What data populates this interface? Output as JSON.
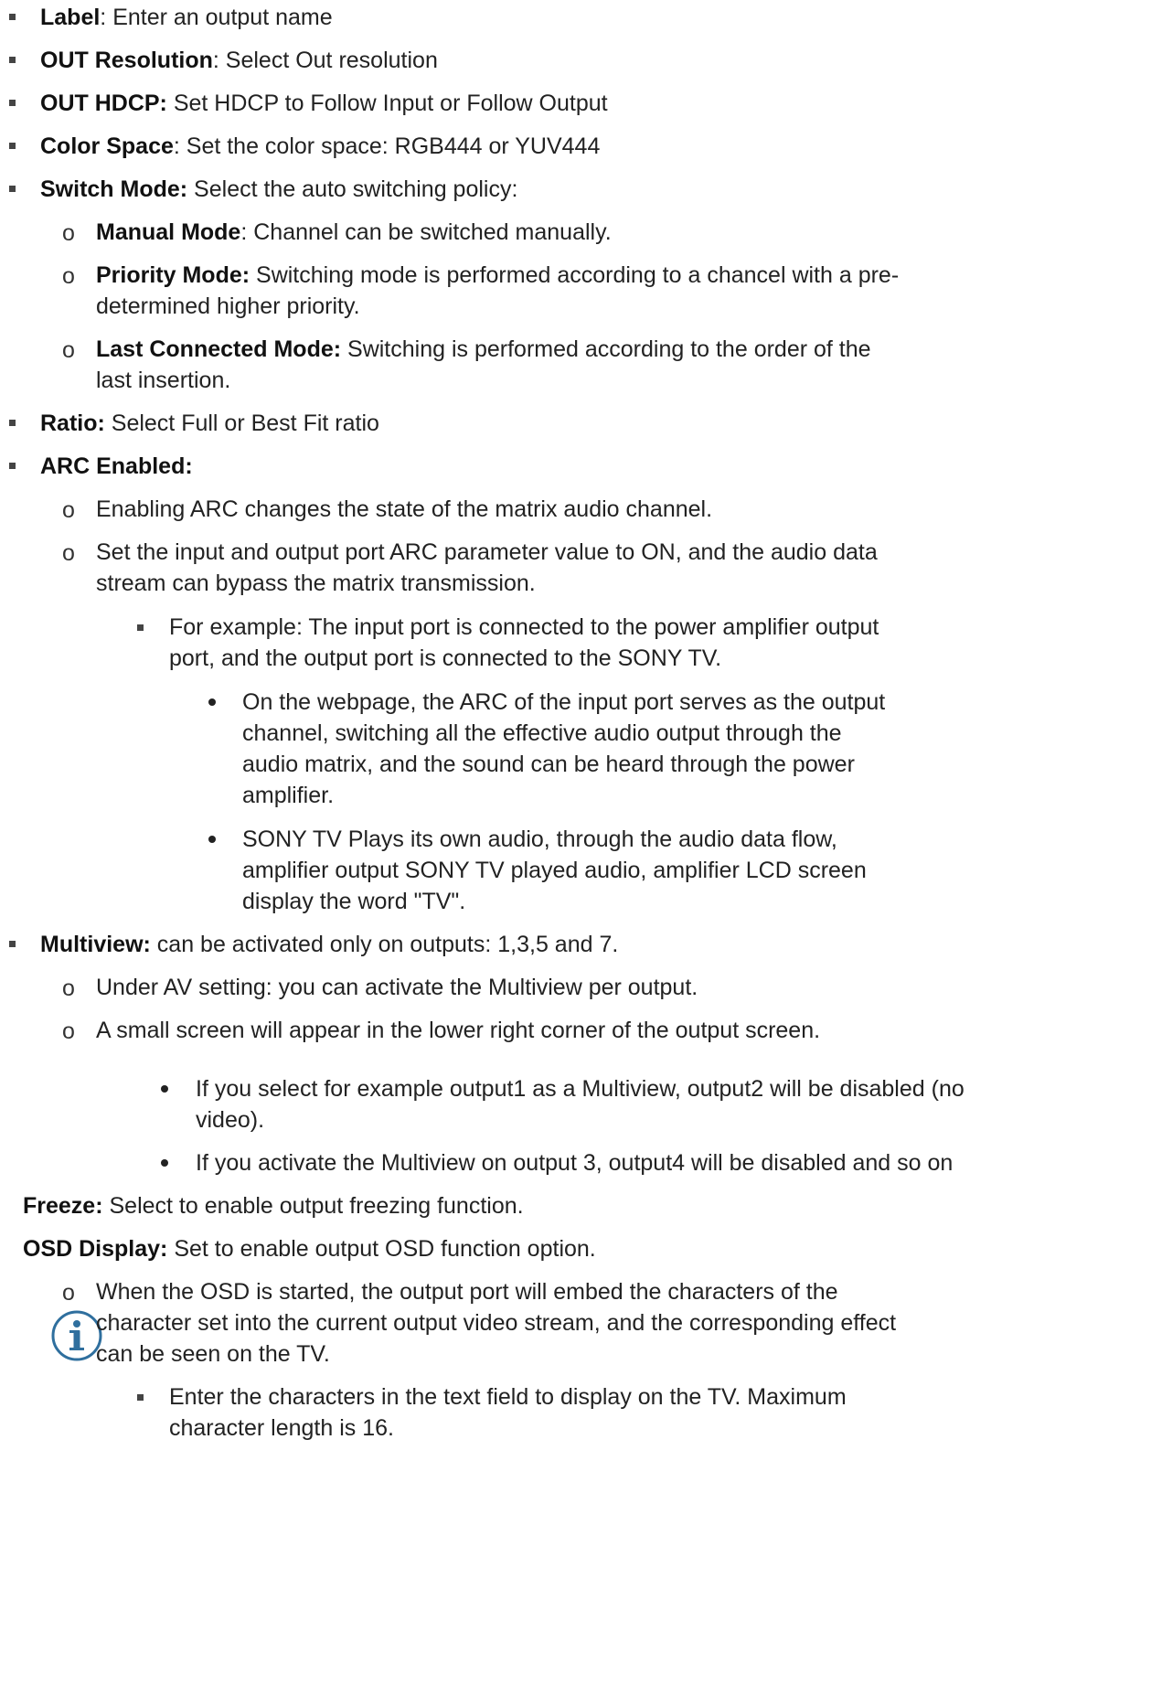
{
  "items": {
    "label": {
      "term": "Label",
      "text": ": Enter an output name"
    },
    "out_resolution": {
      "term": "OUT Resolution",
      "text": ": Select Out resolution"
    },
    "out_hdcp": {
      "term": "OUT HDCP:",
      "text": " Set HDCP to Follow Input or Follow Output"
    },
    "color_space": {
      "term": "Color Space",
      "text": ": Set the color space: RGB444 or YUV444"
    },
    "switch_mode": {
      "term": "Switch Mode:",
      "text": " Select the auto switching policy:",
      "manual": {
        "term": "Manual Mode",
        "text": ": Channel can be switched manually."
      },
      "priority": {
        "term": "Priority Mode:",
        "text": " Switching mode is performed according to a chancel with a pre-",
        "text2": "determined higher priority."
      },
      "last": {
        "term": "Last Connected Mode:",
        "text": " Switching is performed according to the order of the",
        "text2": "last insertion."
      }
    },
    "ratio": {
      "term": "Ratio:",
      "text": " Select Full or Best Fit ratio"
    },
    "arc": {
      "term": "ARC Enabled:",
      "sub1": "Enabling ARC changes the state of the matrix audio channel.",
      "sub2_l1": "Set the input and output port ARC parameter value to ON, and the audio data",
      "sub2_l2": "stream can bypass the matrix transmission.",
      "example_l1": "For example: The input port is connected to the power amplifier output",
      "example_l2": "port, and the output port is connected to the SONY TV.",
      "b1_l1": "On the webpage, the ARC of the input port serves as the output",
      "b1_l2": "channel, switching all the effective audio output through the",
      "b1_l3": "audio matrix, and the sound can be heard through the power",
      "b1_l4": "amplifier.",
      "b2_l1": "SONY TV Plays its own audio, through the audio data flow,",
      "b2_l2": "amplifier output SONY TV played audio, amplifier LCD screen",
      "b2_l3": "display the word \"TV\"."
    },
    "multiview": {
      "term": "Multiview:",
      "text": " can be activated only on outputs: 1,3,5 and 7.",
      "sub1": "Under AV setting: you can activate the Multiview per output.",
      "sub2": "A small screen will appear in the lower right corner of the output screen.",
      "note1_l1": "If you select for example output1 as a Multiview, output2 will be disabled (no",
      "note1_l2": "video).",
      "note2": "If you activate the Multiview on output 3, output4 will be disabled and so on"
    },
    "freeze": {
      "term": "Freeze:",
      "text": " Select to enable output freezing function."
    },
    "osd": {
      "term": "OSD Display:",
      "text": " Set to enable output OSD function option.",
      "sub1_l1": "When the OSD is started, the output port will embed the characters of the",
      "sub1_l2": "character set into the current output video stream, and the corresponding effect",
      "sub1_l3": "can be seen on the TV.",
      "bullet_l1": "Enter the characters in the text field to display on the TV. Maximum",
      "bullet_l2": "character length is 16."
    }
  },
  "symbols": {
    "open_bullet": "o",
    "info_icon": "info-icon"
  },
  "colors": {
    "info_icon": "#2f6f9e",
    "text": "#222222"
  }
}
